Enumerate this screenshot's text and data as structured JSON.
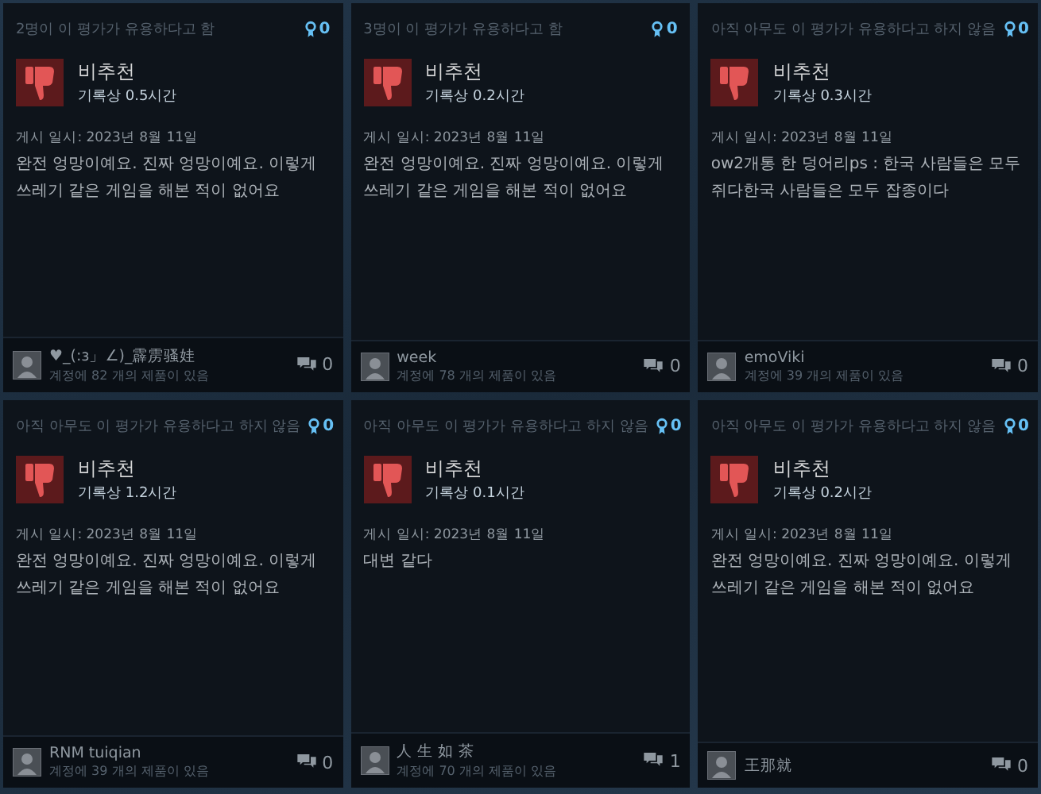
{
  "reviews": [
    {
      "helpful": "2명이 이 평가가 유용하다고 함",
      "awards": "0",
      "verdict": "비추천",
      "recommended": false,
      "hours": "기록상 0.5시간",
      "posted": "게시 일시: 2023년 8월 11일",
      "text": "완전 엉망이예요. 진짜 엉망이예요. 이렇게 쓰레기 같은 게임을 해본 적이 없어요",
      "author": "♥_(:з」∠)_霹雳骚娃",
      "products": "계정에 82 개의 제품이 있음",
      "comments": "0"
    },
    {
      "helpful": "3명이 이 평가가 유용하다고 함",
      "awards": "0",
      "verdict": "비추천",
      "recommended": false,
      "hours": "기록상 0.2시간",
      "posted": "게시 일시: 2023년 8월 11일",
      "text": "완전 엉망이예요. 진짜 엉망이예요. 이렇게 쓰레기 같은 게임을 해본 적이 없어요",
      "author": "week",
      "products": "계정에 78 개의 제품이 있음",
      "comments": "0"
    },
    {
      "helpful": "아직 아무도 이 평가가 유용하다고 하지 않음",
      "awards": "0",
      "verdict": "비추천",
      "recommended": false,
      "hours": "기록상 0.3시간",
      "posted": "게시 일시: 2023년 8월 11일",
      "text": "ow2개통 한 덩어리ps : 한국 사람들은 모두 쥐다한국 사람들은 모두 잡종이다",
      "author": "emoViki",
      "products": "계정에 39 개의 제품이 있음",
      "comments": "0"
    },
    {
      "helpful": "아직 아무도 이 평가가 유용하다고 하지 않음",
      "awards": "0",
      "verdict": "비추천",
      "recommended": false,
      "hours": "기록상 1.2시간",
      "posted": "게시 일시: 2023년 8월 11일",
      "text": "완전 엉망이예요. 진짜 엉망이예요. 이렇게 쓰레기 같은 게임을 해본 적이 없어요",
      "author": "RNM tuiqian",
      "products": "계정에 39 개의 제품이 있음",
      "comments": "0"
    },
    {
      "helpful": "아직 아무도 이 평가가 유용하다고 하지 않음",
      "awards": "0",
      "verdict": "비추천",
      "recommended": false,
      "hours": "기록상 0.1시간",
      "posted": "게시 일시: 2023년 8월 11일",
      "text": "대변 같다",
      "author": "人 生 如 茶",
      "products": "계정에 70 개의 제품이 있음",
      "comments": "1"
    },
    {
      "helpful": "아직 아무도 이 평가가 유용하다고 하지 않음",
      "awards": "0",
      "verdict": "비추천",
      "recommended": false,
      "hours": "기록상 0.2시간",
      "posted": "게시 일시: 2023년 8월 11일",
      "text": "완전 엉망이예요. 진짜 엉망이예요. 이렇게 쓰레기 같은 게임을 해본 적이 없어요",
      "author": "王那就",
      "comments": "0"
    }
  ]
}
